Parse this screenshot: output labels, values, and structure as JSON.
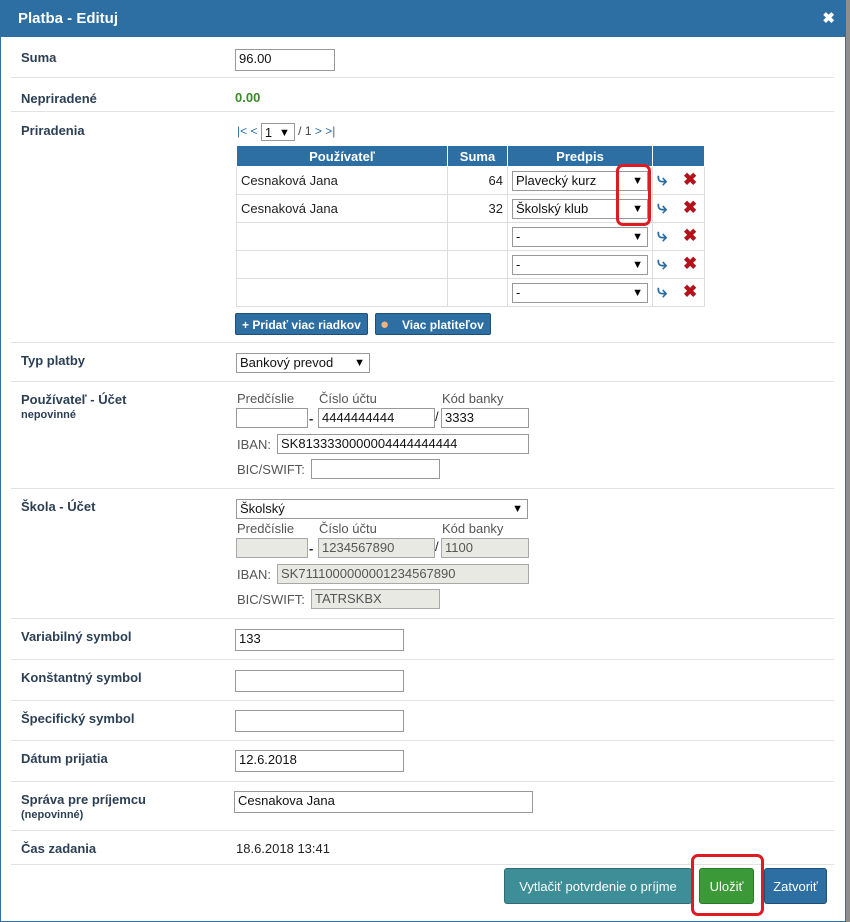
{
  "dialog": {
    "title": "Platba - Edituj",
    "close_icon": "close-icon"
  },
  "suma": {
    "label": "Suma",
    "value": "96.00"
  },
  "nepriradene": {
    "label": "Nepriradené",
    "value": "0.00"
  },
  "priradenia": {
    "label": "Priradenia",
    "pager": {
      "first": "|<",
      "prev": "<",
      "page": "1",
      "total": "/ 1",
      "next": ">",
      "last": ">|"
    },
    "columns": [
      "Používateľ",
      "Suma",
      "Predpis"
    ],
    "rows": [
      {
        "user": "Cesnaková Jana",
        "sum": "64",
        "predpis": "Plavecký kurz"
      },
      {
        "user": "Cesnaková Jana",
        "sum": "32",
        "predpis": "Školský klub"
      },
      {
        "user": "",
        "sum": "",
        "predpis": "-"
      },
      {
        "user": "",
        "sum": "",
        "predpis": "-"
      },
      {
        "user": "",
        "sum": "",
        "predpis": "-"
      }
    ],
    "add_rows_button": "+ Pridať viac riadkov",
    "more_payers_button": "Viac platiteľov"
  },
  "typ_platby": {
    "label": "Typ platby",
    "value": "Bankový prevod"
  },
  "pouzivatel_ucet": {
    "label": "Používateľ - Účet",
    "sublabel": "nepovinné",
    "predcislie_label": "Predčíslie",
    "cislo_label": "Číslo účtu",
    "kod_label": "Kód banky",
    "predcislie": "",
    "cislo": "4444444444",
    "kod": "3333",
    "iban_label": "IBAN:",
    "iban": "SK8133330000004444444444",
    "bic_label": "BIC/SWIFT:",
    "bic": ""
  },
  "skola_ucet": {
    "label": "Škola - Účet",
    "select": "Školský",
    "predcislie_label": "Predčíslie",
    "cislo_label": "Číslo účtu",
    "kod_label": "Kód banky",
    "predcislie": "",
    "cislo": "1234567890",
    "kod": "1100",
    "iban_label": "IBAN:",
    "iban": "SK7111000000001234567890",
    "bic_label": "BIC/SWIFT:",
    "bic": "TATRSKBX"
  },
  "variabilny": {
    "label": "Variabilný symbol",
    "value": "133"
  },
  "konstantny": {
    "label": "Konštantný symbol",
    "value": ""
  },
  "specificky": {
    "label": "Špecifický symbol",
    "value": ""
  },
  "datum": {
    "label": "Dátum prijatia",
    "value": "12.6.2018"
  },
  "sprava": {
    "label": "Správa pre príjemcu",
    "sublabel": "(nepovinné)",
    "value": "Cesnakova Jana"
  },
  "cas": {
    "label": "Čas zadania",
    "value": "18.6.2018 13:41"
  },
  "footer": {
    "print_button": "Vytlačiť potvrdenie o príjme",
    "save_button": "Uložiť",
    "close_button": "Zatvoriť"
  },
  "colors": {
    "header": "#2d6ea3",
    "save": "#3b9a37",
    "highlight": "#e01a22"
  }
}
